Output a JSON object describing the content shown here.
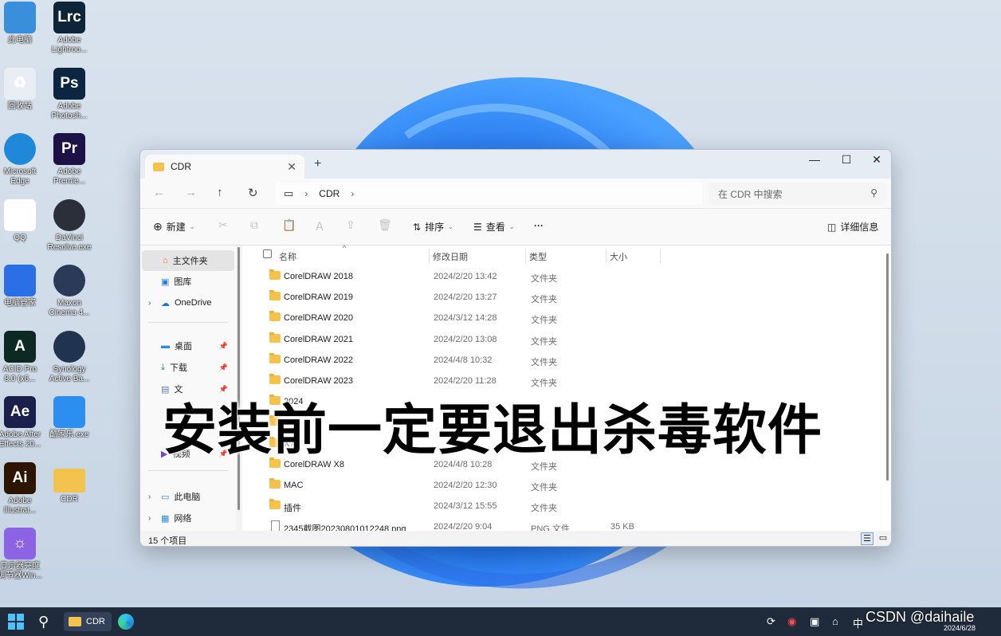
{
  "desktop": {
    "icons": [
      {
        "label": "此电脑",
        "icon": "computer-icon",
        "color": "#3a8fdc"
      },
      {
        "label": "回收站",
        "icon": "recycle-bin-icon",
        "color": "#e9eef4"
      },
      {
        "label": "Microsoft\nEdge",
        "icon": "edge-icon",
        "color": "#1f88d8"
      },
      {
        "label": "QQ",
        "icon": "qq-icon",
        "color": "#ffffff"
      },
      {
        "label": "电脑管家",
        "icon": "pc-manager-icon",
        "color": "#2b6fe6"
      },
      {
        "label": "ACID Pro\n8.0 (x6...",
        "icon": "acid-pro-icon",
        "color": "#0d2a22"
      },
      {
        "label": "Adobe After\nEffects 20...",
        "icon": "after-effects-icon",
        "color": "#1a1f4b"
      },
      {
        "label": "Adobe\nIllustrat...",
        "icon": "illustrator-icon",
        "color": "#2d1500"
      },
      {
        "label": "显示器亮度\n调节器Win...",
        "icon": "brightness-icon",
        "color": "#8d63e6"
      },
      {
        "label": "Adobe\nLightroo...",
        "icon": "lightroom-icon",
        "color": "#0d2439"
      },
      {
        "label": "Adobe\nPhotosh...",
        "icon": "photoshop-icon",
        "color": "#0c2641"
      },
      {
        "label": "Adobe\nPremie...",
        "icon": "premiere-icon",
        "color": "#1d1246"
      },
      {
        "label": "DaVinci\nResolve.exe",
        "icon": "davinci-icon",
        "color": "#2a2f3a"
      },
      {
        "label": "Maxon\nCinema 4...",
        "icon": "cinema4d-icon",
        "color": "#2b3a59"
      },
      {
        "label": "Synology\nActive Ba...",
        "icon": "synology-icon",
        "color": "#203450"
      },
      {
        "label": "酷家乐.exe",
        "icon": "kujiale-icon",
        "color": "#2c8ef0"
      },
      {
        "label": "CDR",
        "icon": "folder-icon",
        "color": "#f4c34d"
      }
    ],
    "icon_glyphs": [
      "",
      "♻",
      "",
      "",
      "",
      "A",
      "Ae",
      "Ai",
      "☼",
      "Lrc",
      "Ps",
      "Pr",
      "",
      "",
      "",
      "",
      ""
    ]
  },
  "explorer": {
    "tab_title": "CDR",
    "new_tab": "+",
    "address": {
      "path_root_icon": "monitor-icon",
      "segment": "CDR"
    },
    "search_placeholder": "在 CDR 中搜索",
    "toolbar": {
      "new": "新建",
      "sort": "排序",
      "view": "查看",
      "more": "···",
      "details": "详细信息"
    },
    "sidebar": {
      "home": "主文件夹",
      "gallery": "图库",
      "onedrive": "OneDrive",
      "desktop": "桌面",
      "downloads": "下载",
      "documents": "文",
      "videos": "视频",
      "this_pc": "此电脑",
      "network": "网络"
    },
    "columns": {
      "name": "名称",
      "modified": "修改日期",
      "type": "类型",
      "size": "大小"
    },
    "files": [
      {
        "name": "CorelDRAW 2018",
        "date": "2024/2/20 13:42",
        "type": "文件夹",
        "size": "",
        "kind": "folder"
      },
      {
        "name": "CorelDRAW 2019",
        "date": "2024/2/20 13:27",
        "type": "文件夹",
        "size": "",
        "kind": "folder"
      },
      {
        "name": "CorelDRAW 2020",
        "date": "2024/3/12 14:28",
        "type": "文件夹",
        "size": "",
        "kind": "folder"
      },
      {
        "name": "CorelDRAW 2021",
        "date": "2024/2/20 13:08",
        "type": "文件夹",
        "size": "",
        "kind": "folder"
      },
      {
        "name": "CorelDRAW 2022",
        "date": "2024/4/8 10:32",
        "type": "文件夹",
        "size": "",
        "kind": "folder"
      },
      {
        "name": "CorelDRAW 2023",
        "date": "2024/2/20 11:28",
        "type": "文件夹",
        "size": "",
        "kind": "folder"
      },
      {
        "name": "2024",
        "date": "",
        "type": "",
        "size": "",
        "kind": "folder"
      },
      {
        "name": "",
        "date": "",
        "type": "",
        "size": "",
        "kind": "folder"
      },
      {
        "name": "X7",
        "date": "",
        "type": "",
        "size": "",
        "kind": "folder"
      },
      {
        "name": "CorelDRAW X8",
        "date": "2024/4/8 10:28",
        "type": "文件夹",
        "size": "",
        "kind": "folder"
      },
      {
        "name": "MAC",
        "date": "2024/2/20 12:30",
        "type": "文件夹",
        "size": "",
        "kind": "folder"
      },
      {
        "name": "插件",
        "date": "2024/3/12 15:55",
        "type": "文件夹",
        "size": "",
        "kind": "folder"
      },
      {
        "name": "2345截图20230801012248.png",
        "date": "2024/2/20 9:04",
        "type": "PNG 文件",
        "size": "35 KB",
        "kind": "png"
      }
    ],
    "status": "15 个项目"
  },
  "overlay_caption": "安装前一定要退出杀毒软件",
  "taskbar": {
    "active_app": "CDR",
    "ime": "中",
    "date": "2024/6/28"
  },
  "watermark": "CSDN @daihaile"
}
